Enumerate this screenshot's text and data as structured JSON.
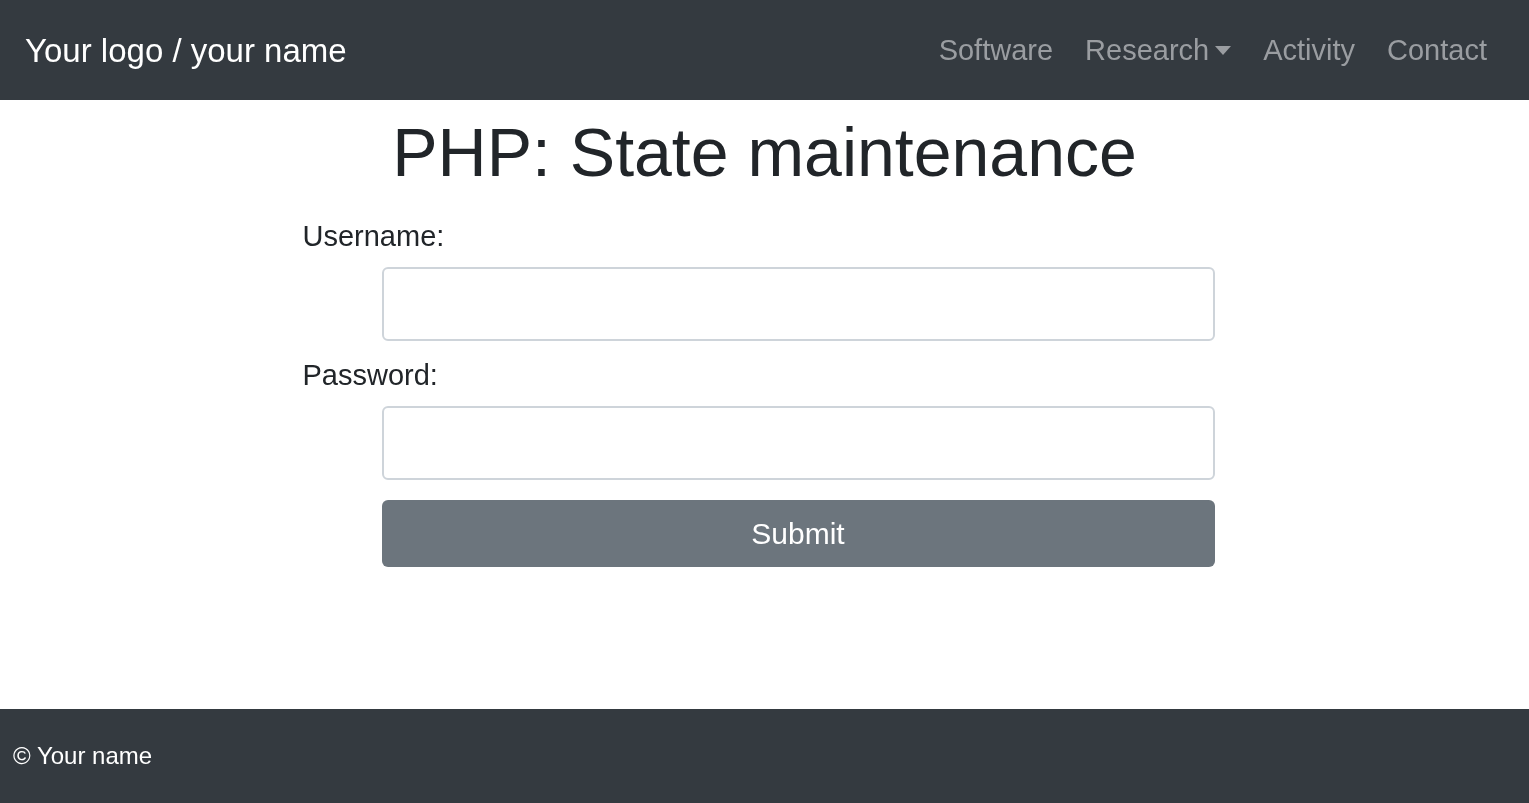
{
  "navbar": {
    "brand": "Your logo / your name",
    "links": [
      {
        "label": "Software",
        "dropdown": false
      },
      {
        "label": "Research",
        "dropdown": true
      },
      {
        "label": "Activity",
        "dropdown": false
      },
      {
        "label": "Contact",
        "dropdown": false
      }
    ]
  },
  "heading": "PHP: State maintenance",
  "form": {
    "fields": [
      {
        "label": "Username:"
      },
      {
        "label": "Password:"
      }
    ],
    "submit": "Submit"
  },
  "footer": "© Your name"
}
